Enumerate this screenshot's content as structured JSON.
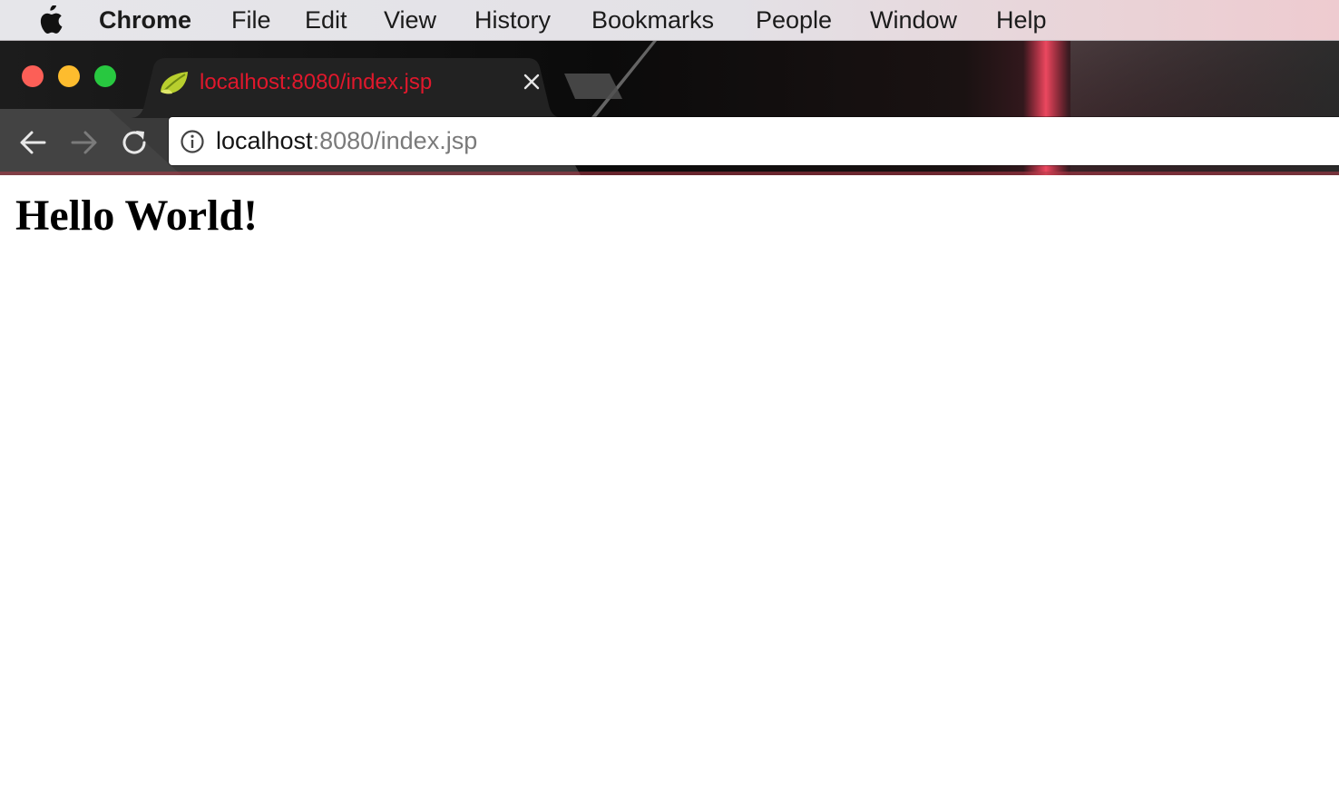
{
  "menubar": {
    "apple_icon": "apple-logo-icon",
    "app_name": "Chrome",
    "items": [
      "File",
      "Edit",
      "View",
      "History",
      "Bookmarks",
      "People",
      "Window",
      "Help"
    ]
  },
  "window": {
    "traffic_lights": {
      "close_color": "#fc5f57",
      "minimize_color": "#fdbc2e",
      "maximize_color": "#28c840"
    },
    "tabs": [
      {
        "title": "localhost:8080/index.jsp",
        "favicon": "spring-leaf-icon",
        "active": true,
        "title_color": "#e0182c"
      }
    ],
    "toolbar": {
      "back_icon": "back-arrow-icon",
      "forward_icon": "forward-arrow-icon",
      "reload_icon": "reload-icon"
    },
    "omnibox": {
      "security_icon": "info-icon",
      "url_host": "localhost",
      "url_rest": ":8080/index.jsp"
    }
  },
  "page": {
    "heading": "Hello World!"
  }
}
